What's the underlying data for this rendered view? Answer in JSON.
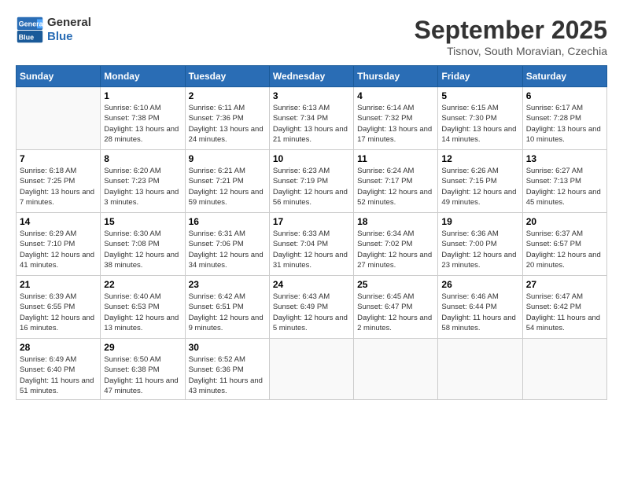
{
  "header": {
    "logo_general": "General",
    "logo_blue": "Blue",
    "month_title": "September 2025",
    "subtitle": "Tisnov, South Moravian, Czechia"
  },
  "weekdays": [
    "Sunday",
    "Monday",
    "Tuesday",
    "Wednesday",
    "Thursday",
    "Friday",
    "Saturday"
  ],
  "weeks": [
    [
      {
        "day": "",
        "empty": true
      },
      {
        "day": "1",
        "sunrise": "6:10 AM",
        "sunset": "7:38 PM",
        "daylight": "13 hours and 28 minutes."
      },
      {
        "day": "2",
        "sunrise": "6:11 AM",
        "sunset": "7:36 PM",
        "daylight": "13 hours and 24 minutes."
      },
      {
        "day": "3",
        "sunrise": "6:13 AM",
        "sunset": "7:34 PM",
        "daylight": "13 hours and 21 minutes."
      },
      {
        "day": "4",
        "sunrise": "6:14 AM",
        "sunset": "7:32 PM",
        "daylight": "13 hours and 17 minutes."
      },
      {
        "day": "5",
        "sunrise": "6:15 AM",
        "sunset": "7:30 PM",
        "daylight": "13 hours and 14 minutes."
      },
      {
        "day": "6",
        "sunrise": "6:17 AM",
        "sunset": "7:28 PM",
        "daylight": "13 hours and 10 minutes."
      }
    ],
    [
      {
        "day": "7",
        "sunrise": "6:18 AM",
        "sunset": "7:25 PM",
        "daylight": "13 hours and 7 minutes."
      },
      {
        "day": "8",
        "sunrise": "6:20 AM",
        "sunset": "7:23 PM",
        "daylight": "13 hours and 3 minutes."
      },
      {
        "day": "9",
        "sunrise": "6:21 AM",
        "sunset": "7:21 PM",
        "daylight": "12 hours and 59 minutes."
      },
      {
        "day": "10",
        "sunrise": "6:23 AM",
        "sunset": "7:19 PM",
        "daylight": "12 hours and 56 minutes."
      },
      {
        "day": "11",
        "sunrise": "6:24 AM",
        "sunset": "7:17 PM",
        "daylight": "12 hours and 52 minutes."
      },
      {
        "day": "12",
        "sunrise": "6:26 AM",
        "sunset": "7:15 PM",
        "daylight": "12 hours and 49 minutes."
      },
      {
        "day": "13",
        "sunrise": "6:27 AM",
        "sunset": "7:13 PM",
        "daylight": "12 hours and 45 minutes."
      }
    ],
    [
      {
        "day": "14",
        "sunrise": "6:29 AM",
        "sunset": "7:10 PM",
        "daylight": "12 hours and 41 minutes."
      },
      {
        "day": "15",
        "sunrise": "6:30 AM",
        "sunset": "7:08 PM",
        "daylight": "12 hours and 38 minutes."
      },
      {
        "day": "16",
        "sunrise": "6:31 AM",
        "sunset": "7:06 PM",
        "daylight": "12 hours and 34 minutes."
      },
      {
        "day": "17",
        "sunrise": "6:33 AM",
        "sunset": "7:04 PM",
        "daylight": "12 hours and 31 minutes."
      },
      {
        "day": "18",
        "sunrise": "6:34 AM",
        "sunset": "7:02 PM",
        "daylight": "12 hours and 27 minutes."
      },
      {
        "day": "19",
        "sunrise": "6:36 AM",
        "sunset": "7:00 PM",
        "daylight": "12 hours and 23 minutes."
      },
      {
        "day": "20",
        "sunrise": "6:37 AM",
        "sunset": "6:57 PM",
        "daylight": "12 hours and 20 minutes."
      }
    ],
    [
      {
        "day": "21",
        "sunrise": "6:39 AM",
        "sunset": "6:55 PM",
        "daylight": "12 hours and 16 minutes."
      },
      {
        "day": "22",
        "sunrise": "6:40 AM",
        "sunset": "6:53 PM",
        "daylight": "12 hours and 13 minutes."
      },
      {
        "day": "23",
        "sunrise": "6:42 AM",
        "sunset": "6:51 PM",
        "daylight": "12 hours and 9 minutes."
      },
      {
        "day": "24",
        "sunrise": "6:43 AM",
        "sunset": "6:49 PM",
        "daylight": "12 hours and 5 minutes."
      },
      {
        "day": "25",
        "sunrise": "6:45 AM",
        "sunset": "6:47 PM",
        "daylight": "12 hours and 2 minutes."
      },
      {
        "day": "26",
        "sunrise": "6:46 AM",
        "sunset": "6:44 PM",
        "daylight": "11 hours and 58 minutes."
      },
      {
        "day": "27",
        "sunrise": "6:47 AM",
        "sunset": "6:42 PM",
        "daylight": "11 hours and 54 minutes."
      }
    ],
    [
      {
        "day": "28",
        "sunrise": "6:49 AM",
        "sunset": "6:40 PM",
        "daylight": "11 hours and 51 minutes."
      },
      {
        "day": "29",
        "sunrise": "6:50 AM",
        "sunset": "6:38 PM",
        "daylight": "11 hours and 47 minutes."
      },
      {
        "day": "30",
        "sunrise": "6:52 AM",
        "sunset": "6:36 PM",
        "daylight": "11 hours and 43 minutes."
      },
      {
        "day": "",
        "empty": true
      },
      {
        "day": "",
        "empty": true
      },
      {
        "day": "",
        "empty": true
      },
      {
        "day": "",
        "empty": true
      }
    ]
  ],
  "labels": {
    "sunrise": "Sunrise:",
    "sunset": "Sunset:",
    "daylight": "Daylight:"
  }
}
